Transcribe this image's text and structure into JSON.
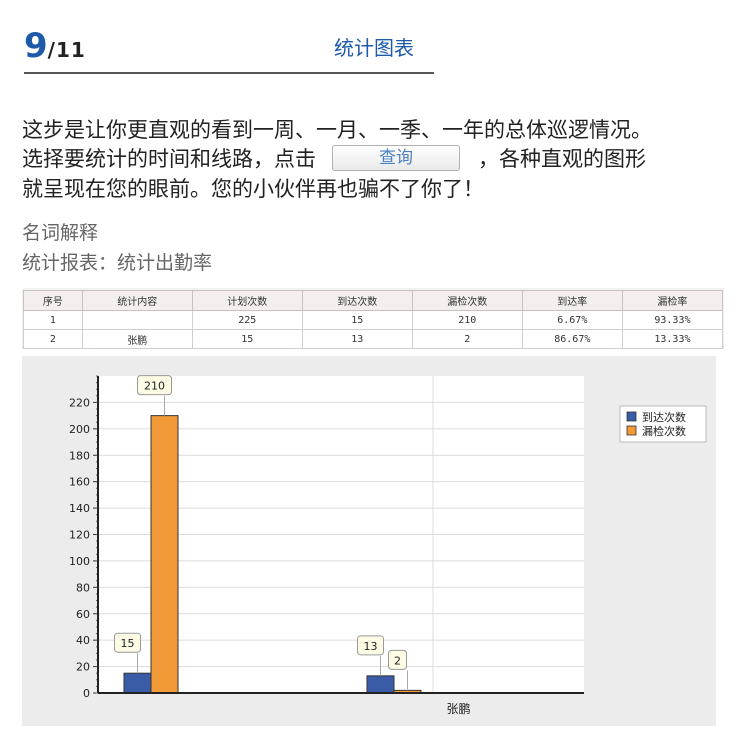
{
  "header": {
    "page_current": "9",
    "page_total": "/11",
    "title": "统计图表"
  },
  "description": {
    "line1": "这步是让你更直观的看到一周、一月、一季、一年的总体巡逻情况。",
    "line2_before": "选择要统计的时间和线路，点击",
    "query_button": "查询",
    "line2_after": "，各种直观的图形",
    "line3": "就呈现在您的眼前。您的小伙伴再也骗不了你了！"
  },
  "terms": {
    "title": "名词解释",
    "line": "统计报表：统计出勤率"
  },
  "table": {
    "headers": [
      "序号",
      "统计内容",
      "计划次数",
      "到达次数",
      "漏检次数",
      "到达率",
      "漏检率"
    ],
    "rows": [
      [
        "1",
        "",
        "225",
        "15",
        "210",
        "6.67%",
        "93.33%"
      ],
      [
        "2",
        "张鹏",
        "15",
        "13",
        "2",
        "86.67%",
        "13.33%"
      ]
    ]
  },
  "chart_data": {
    "type": "bar",
    "categories": [
      "",
      "张鹏"
    ],
    "series": [
      {
        "name": "到达次数",
        "values": [
          15,
          13
        ],
        "color": "#3a5ca6"
      },
      {
        "name": "漏检次数",
        "values": [
          210,
          2
        ],
        "color": "#f29a38"
      }
    ],
    "y_ticks": [
      0,
      20,
      40,
      60,
      80,
      100,
      120,
      140,
      160,
      180,
      200,
      220
    ],
    "ylim": [
      0,
      240
    ],
    "grid": true,
    "legend": "top-right"
  }
}
